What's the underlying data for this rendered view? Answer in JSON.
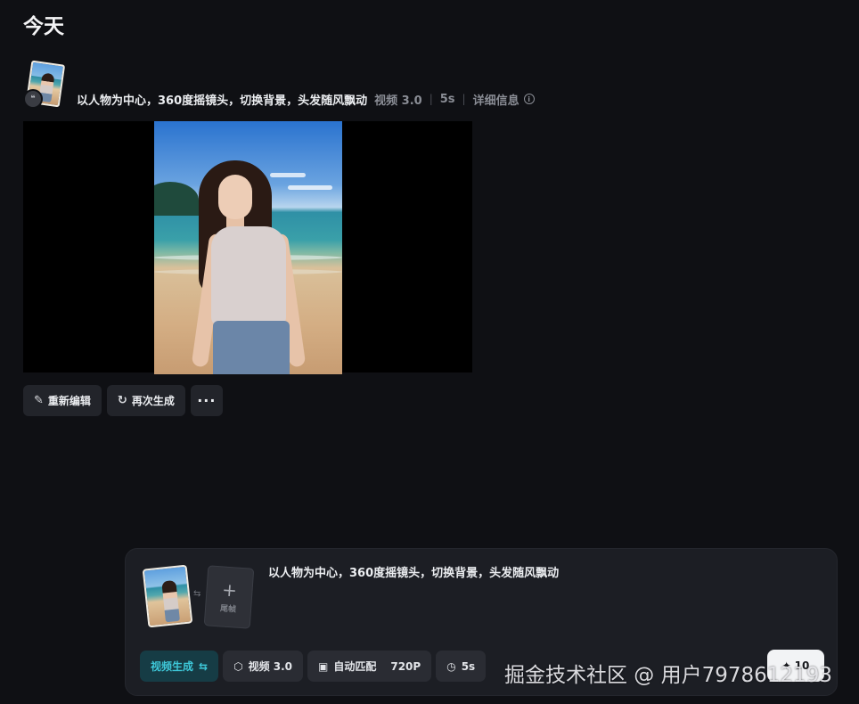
{
  "section": {
    "title": "今天"
  },
  "record": {
    "prompt": "以人物为中心，360度摇镜头，切换背景，头发随风飘动",
    "model": "视频 3.0",
    "duration": "5s",
    "details_label": "详细信息",
    "actions": {
      "reedit": "重新编辑",
      "regenerate": "再次生成",
      "more": "···"
    }
  },
  "composer": {
    "prompt": "以人物为中心，360度摇镜头，切换背景，头发随风飘动",
    "end_frame_label": "尾帧",
    "mode": "视频生成",
    "model": "视频 3.0",
    "aspect": "自动匹配",
    "resolution": "720P",
    "duration": "5s",
    "submit_label": "10"
  },
  "watermark": "掘金技术社区 @ 用户7978612193",
  "colors": {
    "accent": "#3ec8d9",
    "background": "#0f1014",
    "panel": "#1c1e24"
  }
}
